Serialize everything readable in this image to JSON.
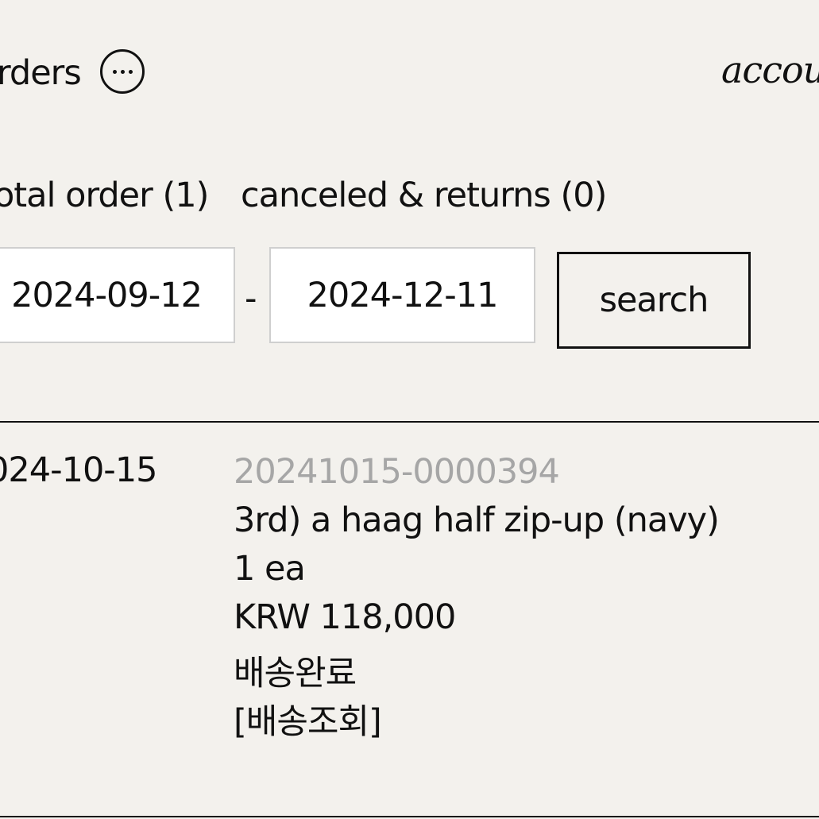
{
  "header": {
    "title": "rders",
    "account_label": "accoun"
  },
  "tabs": [
    {
      "label": "otal order (1)"
    },
    {
      "label": "canceled & returns (0)"
    }
  ],
  "filter": {
    "start_date": "2024-09-12",
    "separator": "-",
    "end_date": "2024-12-11",
    "search_label": "search"
  },
  "orders": [
    {
      "date": "024-10-15",
      "order_number": "20241015-0000394",
      "product_name": "3rd) a haag half zip-up (navy)",
      "quantity": "1 ea",
      "price": "KRW 118,000",
      "status": "배송완료",
      "tracking_label": "[배송조회]"
    }
  ],
  "colors": {
    "background": "#f3f1ed",
    "text": "#111111",
    "muted": "#a6a6a6",
    "input_bg": "#ffffff"
  },
  "icons": {
    "more": "more-horizontal-icon"
  }
}
